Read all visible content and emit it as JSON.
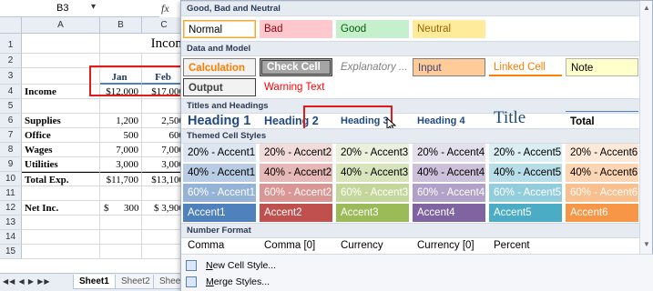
{
  "sheet": {
    "namebox": "B3",
    "fx": "fx",
    "columns": [
      "A",
      "B",
      "C"
    ],
    "rows": [
      {
        "num": "1",
        "a": "",
        "b": "",
        "c": ""
      },
      {
        "num": "2",
        "a": "",
        "b": "",
        "c": ""
      },
      {
        "num": "3",
        "a": "",
        "b": "Jan",
        "c": "Feb"
      },
      {
        "num": "4",
        "a": "Income",
        "b": "$12,000",
        "c": "$17,000"
      },
      {
        "num": "5",
        "a": "",
        "b": "",
        "c": ""
      },
      {
        "num": "6",
        "a": "Supplies",
        "b": "1,200",
        "c": "2,500"
      },
      {
        "num": "7",
        "a": "Office",
        "b": "500",
        "c": "600"
      },
      {
        "num": "8",
        "a": "Wages",
        "b": "7,000",
        "c": "7,000"
      },
      {
        "num": "9",
        "a": "Utilities",
        "b": "3,000",
        "c": "3,000"
      },
      {
        "num": "10",
        "a": "Total Exp.",
        "b": "$11,700",
        "c": "$13,100"
      },
      {
        "num": "11",
        "a": "",
        "b": "",
        "c": ""
      },
      {
        "num": "12",
        "a": "Net Inc.",
        "b": "$      300",
        "c": "$ 3,900"
      },
      {
        "num": "13",
        "a": "",
        "b": "",
        "c": ""
      },
      {
        "num": "14",
        "a": "",
        "b": "",
        "c": ""
      },
      {
        "num": "15",
        "a": "",
        "b": "",
        "c": ""
      }
    ],
    "title_text": "Incom",
    "tabs": [
      "Sheet1",
      "Sheet2",
      "Sheet3"
    ]
  },
  "gallery": {
    "sections": {
      "good_bad": "Good, Bad and Neutral",
      "data_model": "Data and Model",
      "titles": "Titles and Headings",
      "themed": "Themed Cell Styles",
      "number": "Number Format"
    },
    "good_bad": [
      "Normal",
      "Bad",
      "Good",
      "Neutral"
    ],
    "data_model": [
      "Calculation",
      "Check Cell",
      "Explanatory ...",
      "Input",
      "Linked Cell",
      "Note",
      "Output",
      "Warning Text"
    ],
    "titles": [
      "Heading 1",
      "Heading 2",
      "Heading 3",
      "Heading 4",
      "Title",
      "Total"
    ],
    "themed_20": [
      "20% - Accent1",
      "20% - Accent2",
      "20% - Accent3",
      "20% - Accent4",
      "20% - Accent5",
      "20% - Accent6"
    ],
    "themed_40": [
      "40% - Accent1",
      "40% - Accent2",
      "40% - Accent3",
      "40% - Accent4",
      "40% - Accent5",
      "40% - Accent6"
    ],
    "themed_60": [
      "60% - Accent1",
      "60% - Accent2",
      "60% - Accent3",
      "60% - Accent4",
      "60% - Accent5",
      "60% - Accent6"
    ],
    "themed_acc": [
      "Accent1",
      "Accent2",
      "Accent3",
      "Accent4",
      "Accent5",
      "Accent6"
    ],
    "number": [
      "Comma",
      "Comma [0]",
      "Currency",
      "Currency [0]",
      "Percent"
    ],
    "menu": {
      "new_style_key": "N",
      "new_style_rest": "ew Cell Style...",
      "merge_key": "M",
      "merge_rest": "erge Styles..."
    }
  },
  "colors": {
    "accent1": "#4f81bd",
    "accent2": "#c0504d",
    "accent3": "#9bbb59",
    "accent4": "#8064a2",
    "accent5": "#4bacc6",
    "accent6": "#f79646",
    "highlight": "#e21a1a"
  }
}
